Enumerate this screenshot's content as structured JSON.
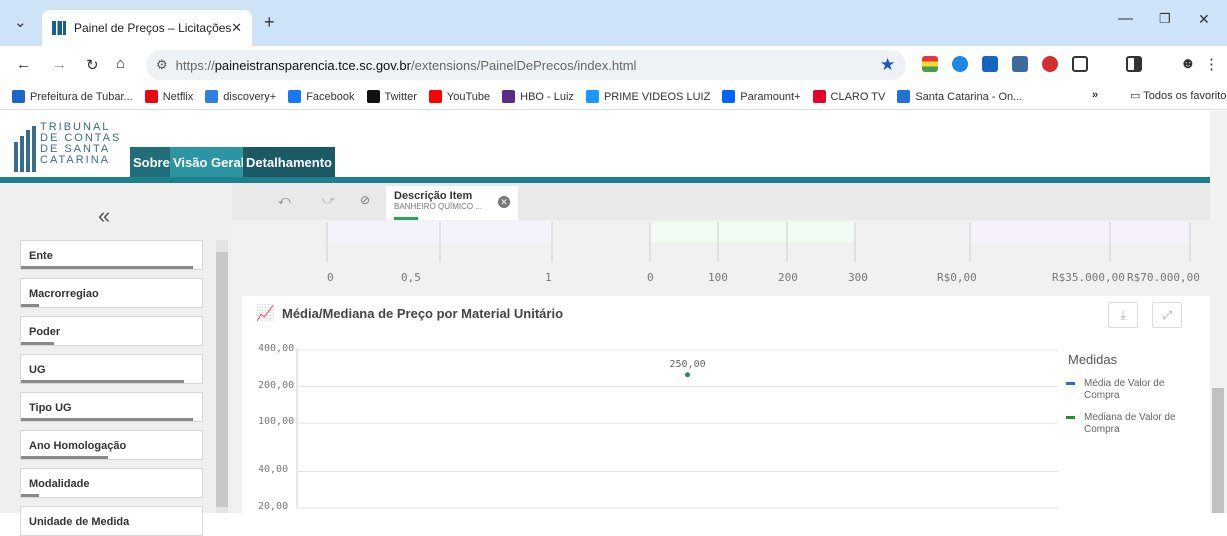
{
  "browser": {
    "tab_title": "Painel de Preços – Licitações",
    "url_protocol": "https://",
    "url_host": "paineistransparencia.tce.sc.gov.br",
    "url_path": "/extensions/PainelDePrecos/index.html",
    "bookmarks": [
      {
        "label": "Prefeitura de Tubar...",
        "color": "#1a66c9"
      },
      {
        "label": "Netflix",
        "color": "#e50914"
      },
      {
        "label": "discovery+",
        "color": "#2f7fe0"
      },
      {
        "label": "Facebook",
        "color": "#1877f2"
      },
      {
        "label": "Twitter",
        "color": "#111111"
      },
      {
        "label": "YouTube",
        "color": "#ff0000"
      },
      {
        "label": "HBO - Luiz",
        "color": "#5b2b8a"
      },
      {
        "label": "PRIME VIDEOS LUIZ",
        "color": "#1a98ff"
      },
      {
        "label": "Paramount+",
        "color": "#0064ff"
      },
      {
        "label": "CLARO TV",
        "color": "#e4002b"
      },
      {
        "label": "Santa Catarina - On...",
        "color": "#1f73d6"
      }
    ],
    "all_favorites": "Todos os favoritos",
    "overflow": "»"
  },
  "app": {
    "logo_lines": [
      "TRIBUNAL",
      "DE CONTAS",
      "DE SANTA",
      "CATARINA"
    ],
    "nav_tabs": [
      {
        "label": "Sobre",
        "color": "#1f6e7a"
      },
      {
        "label": "Visão Geral",
        "color": "#2b95a3"
      },
      {
        "label": "Detalhamento",
        "color": "#1b5a64"
      }
    ],
    "sidebar_items": [
      {
        "label": "Ente",
        "fill": 0.95
      },
      {
        "label": "Macrorregiao",
        "fill": 0.1
      },
      {
        "label": "Poder",
        "fill": 0.18
      },
      {
        "label": "UG",
        "fill": 0.9
      },
      {
        "label": "Tipo UG",
        "fill": 0.95
      },
      {
        "label": "Ano Homologação",
        "fill": 0.48
      },
      {
        "label": "Modalidade",
        "fill": 0.1
      },
      {
        "label": "Unidade de Medida",
        "fill": 0
      }
    ],
    "collapse_icon": "«",
    "selection": {
      "field": "Descrição Item",
      "value": "BANHEIRO QUÍMICO ..."
    }
  },
  "top_axes": {
    "axis1": [
      "0",
      "0,5",
      "1"
    ],
    "axis2": [
      "0",
      "100",
      "200",
      "300"
    ],
    "axis3": [
      "R$0,00",
      "R$35.000,00",
      "R$70.000,00"
    ]
  },
  "chart_data": {
    "type": "line",
    "title": "Média/Mediana de Preço por Material Unitário",
    "ylabel": "",
    "xlabel": "",
    "scale": "log",
    "ylim": [
      20,
      400
    ],
    "yticks": [
      "400,00",
      "200,00",
      "100,00",
      "40,00",
      "20,00"
    ],
    "ytick_values": [
      400,
      200,
      100,
      40,
      20
    ],
    "grid": true,
    "legend_title": "Medidas",
    "legend_position": "right",
    "series": [
      {
        "name": "Média de Valor de Compra",
        "color": "#3a66c9",
        "values": []
      },
      {
        "name": "Mediana de Valor de Compra",
        "color": "#2e8b3a",
        "values": [
          250
        ]
      }
    ],
    "data_labels": [
      "250,00"
    ]
  }
}
